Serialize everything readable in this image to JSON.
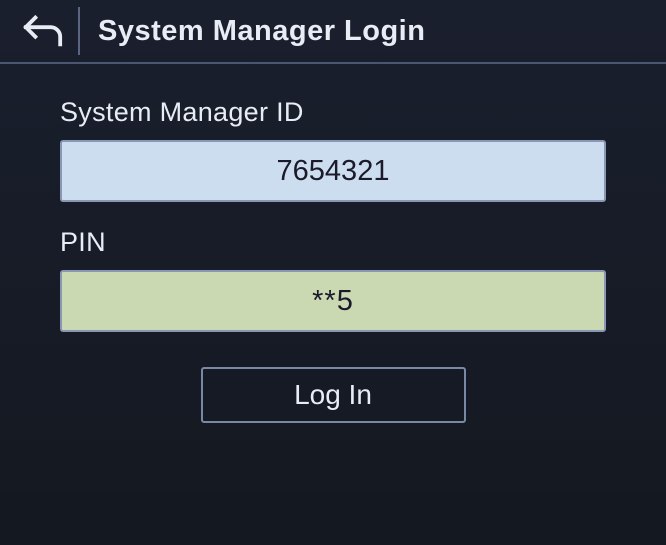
{
  "header": {
    "title": "System Manager Login"
  },
  "form": {
    "id_label": "System Manager ID",
    "id_value": "7654321",
    "pin_label": "PIN",
    "pin_value": "**5",
    "login_label": "Log In"
  }
}
